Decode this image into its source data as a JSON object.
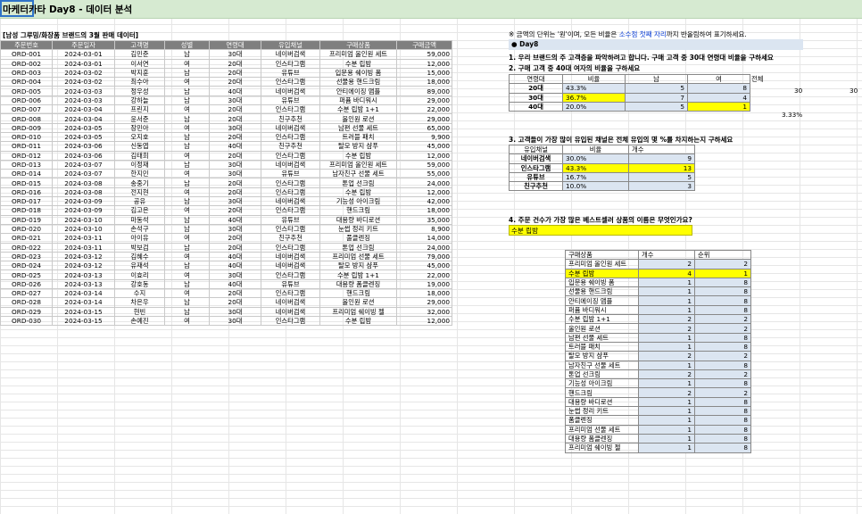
{
  "title": "마케터카타 Day8 - 데이터 분석",
  "caption": "[남성 그루밍/화장품 브랜드의 3월 판매 데이터]",
  "headers": [
    "주문번호",
    "주문일자",
    "고객명",
    "성별",
    "연령대",
    "유입채널",
    "구매상품",
    "구매금액"
  ],
  "rows": [
    [
      "ORD-001",
      "2024-03-01",
      "김민준",
      "남",
      "30대",
      "네이버검색",
      "프리미엄 올인원 세트",
      "59,000"
    ],
    [
      "ORD-002",
      "2024-03-01",
      "이서연",
      "여",
      "20대",
      "인스타그램",
      "수분 립밤",
      "12,000"
    ],
    [
      "ORD-003",
      "2024-03-02",
      "박지훈",
      "남",
      "20대",
      "유튜브",
      "입문용 쉐이빙 폼",
      "15,000"
    ],
    [
      "ORD-004",
      "2024-03-02",
      "최수아",
      "여",
      "20대",
      "인스타그램",
      "선물용 핸드크림",
      "18,000"
    ],
    [
      "ORD-005",
      "2024-03-03",
      "정우성",
      "남",
      "40대",
      "네이버검색",
      "안티에이징 앰플",
      "89,000"
    ],
    [
      "ORD-006",
      "2024-03-03",
      "강하늘",
      "남",
      "30대",
      "유튜브",
      "퍼퓸 바디워시",
      "29,000"
    ],
    [
      "ORD-007",
      "2024-03-04",
      "프린지",
      "여",
      "20대",
      "인스타그램",
      "수분 립밤 1+1",
      "22,000"
    ],
    [
      "ORD-008",
      "2024-03-04",
      "윤서준",
      "남",
      "20대",
      "친구추천",
      "올인원 로션",
      "29,000"
    ],
    [
      "ORD-009",
      "2024-03-05",
      "장민아",
      "여",
      "30대",
      "네이버검색",
      "남편 선물 세트",
      "65,000"
    ],
    [
      "ORD-010",
      "2024-03-05",
      "오지호",
      "남",
      "20대",
      "인스타그램",
      "트러블 패치",
      "9,900"
    ],
    [
      "ORD-011",
      "2024-03-06",
      "신동엽",
      "남",
      "40대",
      "친구추천",
      "탈모 방지 샴푸",
      "45,000"
    ],
    [
      "ORD-012",
      "2024-03-06",
      "김태희",
      "여",
      "20대",
      "인스타그램",
      "수분 립밤",
      "12,000"
    ],
    [
      "ORD-013",
      "2024-03-07",
      "이정재",
      "남",
      "30대",
      "네이버검색",
      "프리미엄 올인원 세트",
      "59,000"
    ],
    [
      "ORD-014",
      "2024-03-07",
      "한지민",
      "여",
      "30대",
      "유튜브",
      "남자친구 선물 세트",
      "55,000"
    ],
    [
      "ORD-015",
      "2024-03-08",
      "송중기",
      "남",
      "20대",
      "인스타그램",
      "톤업 선크림",
      "24,000"
    ],
    [
      "ORD-016",
      "2024-03-08",
      "전지현",
      "여",
      "20대",
      "인스타그램",
      "수분 립밤",
      "12,000"
    ],
    [
      "ORD-017",
      "2024-03-09",
      "공유",
      "남",
      "30대",
      "네이버검색",
      "기능성 아이크림",
      "42,000"
    ],
    [
      "ORD-018",
      "2024-03-09",
      "김고은",
      "여",
      "20대",
      "인스타그램",
      "핸드크림",
      "18,000"
    ],
    [
      "ORD-019",
      "2024-03-10",
      "마동석",
      "남",
      "40대",
      "유튜브",
      "대용량 바디로션",
      "35,000"
    ],
    [
      "ORD-020",
      "2024-03-10",
      "손석구",
      "남",
      "30대",
      "인스타그램",
      "눈썹 정리 키트",
      "8,900"
    ],
    [
      "ORD-021",
      "2024-03-11",
      "아이유",
      "여",
      "20대",
      "친구추천",
      "풀클렌징",
      "14,000"
    ],
    [
      "ORD-022",
      "2024-03-11",
      "박보검",
      "남",
      "20대",
      "인스타그램",
      "톤업 선크림",
      "24,000"
    ],
    [
      "ORD-023",
      "2024-03-12",
      "김혜수",
      "여",
      "40대",
      "네이버검색",
      "프리미엄 선물 세트",
      "79,000"
    ],
    [
      "ORD-024",
      "2024-03-12",
      "유재석",
      "남",
      "40대",
      "네이버검색",
      "탈모 방지 샴푸",
      "45,000"
    ],
    [
      "ORD-025",
      "2024-03-13",
      "이효리",
      "여",
      "30대",
      "인스타그램",
      "수분 립밤 1+1",
      "22,000"
    ],
    [
      "ORD-026",
      "2024-03-13",
      "강호동",
      "남",
      "40대",
      "유튜브",
      "대용량 폼클렌징",
      "19,000"
    ],
    [
      "ORD-027",
      "2024-03-14",
      "수지",
      "여",
      "20대",
      "인스타그램",
      "핸드크림",
      "18,000"
    ],
    [
      "ORD-028",
      "2024-03-14",
      "차은우",
      "남",
      "20대",
      "네이버검색",
      "올인원 로션",
      "29,000"
    ],
    [
      "ORD-029",
      "2024-03-15",
      "현빈",
      "남",
      "30대",
      "네이버검색",
      "프리미엄 쉐이빙 젤",
      "32,000"
    ],
    [
      "ORD-030",
      "2024-03-15",
      "손예진",
      "여",
      "30대",
      "인스타그램",
      "수분 립밤",
      "12,000"
    ]
  ],
  "note_prefix": "※ 금액의 단위는 '원'이며, 모든 비율은 ",
  "note_highlight": "소수점 첫째 자리",
  "note_suffix": "까지 반올림하여 표기하세요.",
  "day_label": "● Day8",
  "q1": "1. 우리 브랜드의 주 고객층을 파악하려고 합니다. 구매 고객 중 30대 연령대 비율을 구하세요",
  "q2": "2. 구매 고객 중 40대 여자의 비율을 구하세요",
  "age_table": {
    "headers": [
      "연령대",
      "비율",
      "남",
      "여",
      "전체"
    ],
    "rows": [
      {
        "label": "20대",
        "ratio": "43.3%",
        "male": "5",
        "female": "8"
      },
      {
        "label": "30대",
        "ratio": "36.7%",
        "male": "7",
        "female": "4"
      },
      {
        "label": "40대",
        "ratio": "20.0%",
        "male": "5",
        "female": "1"
      }
    ],
    "total_a": "30",
    "total_b": "30",
    "extra": "3.33%"
  },
  "q3": "3. 고객들이 가장 많이 유입된 채널은 전체 유입의 몇 %를 차지하는지 구하세요",
  "channel_table": {
    "headers": [
      "유입채널",
      "비율",
      "개수"
    ],
    "rows": [
      {
        "label": "네이버검색",
        "ratio": "30.0%",
        "count": "9"
      },
      {
        "label": "인스타그램",
        "ratio": "43.3%",
        "count": "13"
      },
      {
        "label": "유튜브",
        "ratio": "16.7%",
        "count": "5"
      },
      {
        "label": "친구추천",
        "ratio": "10.0%",
        "count": "3"
      }
    ]
  },
  "q4": "4. 주문 건수가 가장 많은 베스트셀러 상품의 이름은 무엇인가요?",
  "answer4": "수분 립밤",
  "product_table": {
    "headers": [
      "구매상품",
      "개수",
      "순위"
    ],
    "rows": [
      {
        "name": "프리미엄 올인원 세트",
        "count": "2",
        "rank": "2"
      },
      {
        "name": "수분 립밤",
        "count": "4",
        "rank": "1"
      },
      {
        "name": "입문용 쉐이빙 폼",
        "count": "1",
        "rank": "8"
      },
      {
        "name": "선물용 핸드크림",
        "count": "1",
        "rank": "8"
      },
      {
        "name": "안티에이징 앰플",
        "count": "1",
        "rank": "8"
      },
      {
        "name": "퍼퓸 바디워시",
        "count": "1",
        "rank": "8"
      },
      {
        "name": "수분 립밤 1+1",
        "count": "2",
        "rank": "2"
      },
      {
        "name": "올인원 로션",
        "count": "2",
        "rank": "2"
      },
      {
        "name": "남편 선물 세트",
        "count": "1",
        "rank": "8"
      },
      {
        "name": "트러블 패치",
        "count": "1",
        "rank": "8"
      },
      {
        "name": "탈모 방지 샴푸",
        "count": "2",
        "rank": "2"
      },
      {
        "name": "남자친구 선물 세트",
        "count": "1",
        "rank": "8"
      },
      {
        "name": "톤업 선크림",
        "count": "2",
        "rank": "2"
      },
      {
        "name": "기능성 아이크림",
        "count": "1",
        "rank": "8"
      },
      {
        "name": "핸드크림",
        "count": "2",
        "rank": "2"
      },
      {
        "name": "대용량 바디로션",
        "count": "1",
        "rank": "8"
      },
      {
        "name": "눈썹 정리 키트",
        "count": "1",
        "rank": "8"
      },
      {
        "name": "폼클렌징",
        "count": "1",
        "rank": "8"
      },
      {
        "name": "프리미엄 선물 세트",
        "count": "1",
        "rank": "8"
      },
      {
        "name": "대용량 폼클렌징",
        "count": "1",
        "rank": "8"
      },
      {
        "name": "프리미엄 쉐이빙 젤",
        "count": "1",
        "rank": "8"
      }
    ]
  }
}
